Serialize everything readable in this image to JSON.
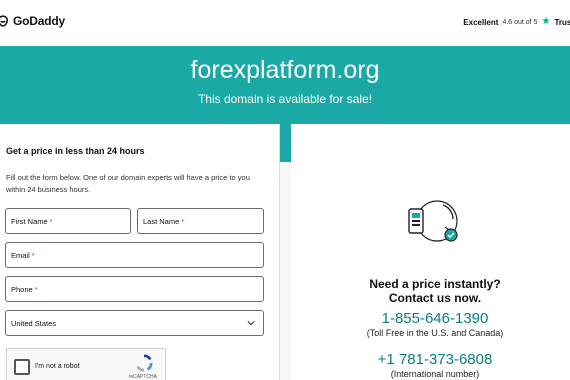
{
  "header": {
    "logo_text": "GoDaddy",
    "rating_label": "Excellent",
    "rating_score": "4.6 out of 5",
    "rating_brand": "Trust"
  },
  "banner": {
    "domain": "forexplatform.org",
    "subtitle": "This domain is available for sale!"
  },
  "form": {
    "heading": "Get a price in less than 24 hours",
    "description": "Fill out the form below. One of our domain experts will have a price to you within 24 business hours.",
    "first_name_label": "First Name",
    "last_name_label": "Last Name",
    "email_label": "Email",
    "phone_label": "Phone",
    "required_mark": "*",
    "country_value": "United States",
    "captcha_label": "I'm not a robot",
    "captcha_brand": "reCAPTCHA"
  },
  "contact": {
    "price_question": "Need a price instantly?",
    "contact_now": "Contact us now.",
    "phone_1": "1-855-646-1390",
    "phone_1_note": "(Toll Free in the U.S. and Canada)",
    "phone_2": "+1 781-373-6808",
    "phone_2_note": "(International number)"
  },
  "colors": {
    "banner": "#1ba9a6",
    "phone_link": "#0b7d7c",
    "trust_star": "#00b67a"
  }
}
